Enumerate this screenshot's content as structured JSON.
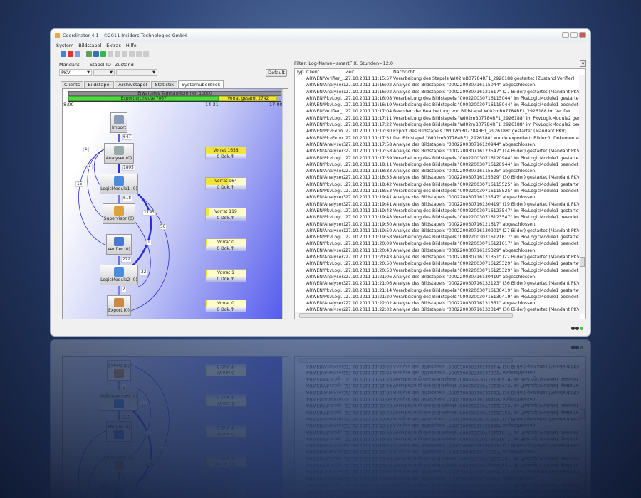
{
  "window": {
    "title": "Coordinator 4.1 - ©2011 Insiders Technologies GmbH"
  },
  "menu": [
    "System",
    "Bildstapel",
    "Extras",
    "Hilfe"
  ],
  "filters": {
    "mandant_label": "Mandant",
    "mandant_value": "PKV",
    "stapel_label": "Stapel-ID",
    "stapel_value": "",
    "zustand_label": "Zustand",
    "zustand_value": "",
    "default_button": "Default"
  },
  "tabs": [
    {
      "label": "Clients"
    },
    {
      "label": "Bildstapel"
    },
    {
      "label": "Archivstapel"
    },
    {
      "label": "Statistik"
    },
    {
      "label": "Systemüberblick",
      "active": true
    }
  ],
  "overview": {
    "expected": "Erwartetes Tagesaufkommen 10000",
    "exported": "Exportiert heute 7067",
    "stock": "Vorrat gesamt 2742",
    "exported_fraction": 0.7067,
    "stock_fraction": 0.2742,
    "time_start": "8:00",
    "time_now": "14:31",
    "time_end": "17:00",
    "nodes": [
      {
        "label": "Import",
        "icon": "scanner-icon"
      },
      {
        "label": "Analyser (0)",
        "icon": "gear-icon"
      },
      {
        "label": "LogicModule1 (0)",
        "icon": "pkv-logic-icon"
      },
      {
        "label": "Supervisor (0)",
        "icon": "supervisor-icon"
      },
      {
        "label": "Verifier (0)",
        "icon": "verifier-icon"
      },
      {
        "label": "LogicModule2 (0)",
        "icon": "pkv-logic-icon"
      },
      {
        "label": "Export (0)",
        "icon": "export-door-icon"
      }
    ],
    "edges": [
      "647",
      "1805",
      "618",
      "1195",
      "56",
      "1",
      "1",
      "1",
      "15",
      "272",
      "22",
      "2"
    ],
    "vorrat": [
      {
        "stock": "Vorrat 1658",
        "rate": "0 Dok./h",
        "fill": 1.0
      },
      {
        "stock": "Vorrat 964",
        "rate": "0 Dok./h",
        "fill": 0.58
      },
      {
        "stock": "Vorrat 119",
        "rate": "0 Dok./h",
        "fill": 0.07
      },
      {
        "stock": "Vorrat 0",
        "rate": "0 Dok./h",
        "fill": 0
      },
      {
        "stock": "Vorrat 1",
        "rate": "0 Dok./h",
        "fill": 0
      },
      {
        "stock": "Vorrat 0",
        "rate": "0 Dok./h",
        "fill": 0
      }
    ]
  },
  "log": {
    "filter": "Filter: Log-Name=smartFIX, Stunden=12,0",
    "columns": [
      "Typ",
      "Client",
      "Zeit",
      "Nachricht"
    ],
    "rows": [
      [
        "",
        "ARWEN/Verifier_...",
        "27.10.2011 11:15:57",
        "Verarbeitung des Stapels WI02mB07784RF1_2926188 gestartet (Zustand Verifier)"
      ],
      [
        "",
        "ARWEN/Analyser1",
        "27.10.2011 11:16:02",
        "Analyse des Bildstapels \"000220030716115044\" abgeschlossen."
      ],
      [
        "",
        "ARWEN/Analyser1",
        "27.10.2011 11:16:02",
        "Analyse des Bildstapels \"000220030716121617\" (27 Bilder) gestartet (Mandant PKV)."
      ],
      [
        "",
        "ARWEN/PkvLogi...",
        "27.10.2011 11:16:08",
        "Verarbeitung des Bildstapels \"000220030716115044\" im PkvLogicModule1 gestartet."
      ],
      [
        "",
        "ARWEN/PkvLogi...",
        "27.10.2011 11:16:19",
        "Verarbeitung des Bildstapels \"000220030716115044\" im PkvLogicModule1 beendet."
      ],
      [
        "",
        "ARWEN/Verifier_...",
        "27.10.2011 11:17:04",
        "Beenden der Bearbeitung von Bildstapel WI02mB07784RF1_2926188 im Verifier"
      ],
      [
        "",
        "ARWEN/PkvLogi...",
        "27.10.2011 11:17:11",
        "Verarbeitung des Bildstapels \"WI02mB07784RF1_2926188\" im PkvLogicModule2 gestartet."
      ],
      [
        "",
        "ARWEN/PkvLogi...",
        "27.10.2011 11:17:22",
        "Verarbeitung des Bildstapels \"WI02mB07784RF1_2926188\" im PkvLogicModule2 beendet."
      ],
      [
        "",
        "ARWEN/PkvExpo...",
        "27.10.2011 11:17:30",
        "Export des Bildstapels \"WI02mB07784RF1_2926188\" gestartet (Mandant PKV)"
      ],
      [
        "",
        "ARWEN/PkvExpo...",
        "27.10.2011 11:17:31",
        "Der Bildstapel \"WI02mB07784RF1_2926188\" wurde exportiert: Bilder:1, Dokumente:1"
      ],
      [
        "",
        "ARWEN/Analyser3",
        "27.10.2011 11:17:58",
        "Analyse des Bildstapels \"000220030716120944\" abgeschlossen."
      ],
      [
        "",
        "ARWEN/Analyser3",
        "27.10.2011 11:17:58",
        "Analyse des Bildstapels \"000220030716123547\" (14 Bilder) gestartet (Mandant PKV)."
      ],
      [
        "",
        "ARWEN/PkvLogi...",
        "27.10.2011 11:17:59",
        "Verarbeitung des Bildstapels \"000220030716120944\" im PkvLogicModule1 gestartet."
      ],
      [
        "",
        "ARWEN/PkvLogi...",
        "27.10.2011 11:18:11",
        "Verarbeitung des Bildstapels \"000220030716120944\" im PkvLogicModule1 beendet."
      ],
      [
        "",
        "ARWEN/Analyser2",
        "27.10.2011 11:18:33",
        "Analyse des Bildstapels \"000220030716115525\" abgeschlossen."
      ],
      [
        "",
        "ARWEN/Analyser2",
        "27.10.2011 11:18:33",
        "Analyse des Bildstapels \"000220030716125329\" (30 Bilder) gestartet (Mandant PKV)."
      ],
      [
        "",
        "ARWEN/PkvLogi...",
        "27.10.2011 11:18:42",
        "Verarbeitung des Bildstapels \"000220030716115525\" im PkvLogicModule1 gestartet."
      ],
      [
        "",
        "ARWEN/PkvLogi...",
        "27.10.2011 11:18:53",
        "Verarbeitung des Bildstapels \"000220030716115525\" im PkvLogicModule1 beendet."
      ],
      [
        "",
        "ARWEN/Analyser3",
        "27.10.2011 11:19:41",
        "Analyse des Bildstapels \"000220030716123547\" abgeschlossen."
      ],
      [
        "",
        "ARWEN/Analyser3",
        "27.10.2011 11:19:41",
        "Analyse des Bildstapels \"000220030716130419\" (19 Bilder) gestartet (Mandant PKV)."
      ],
      [
        "",
        "ARWEN/PkvLogi...",
        "27.10.2011 11:19:43",
        "Verarbeitung des Bildstapels \"000220030716123547\" im PkvLogicModule1 gestartet."
      ],
      [
        "",
        "ARWEN/PkvLogi...",
        "27.10.2011 11:19:48",
        "Verarbeitung des Bildstapels \"000220030716123547\" im PkvLogicModule1 beendet."
      ],
      [
        "",
        "ARWEN/Analyser1",
        "27.10.2011 11:19:50",
        "Analyse des Bildstapels \"000220030716121617\" abgeschlossen."
      ],
      [
        "",
        "ARWEN/Analyser1",
        "27.10.2011 11:19:50",
        "Analyse des Bildstapels \"000220030716130901\" (27 Bilder) gestartet (Mandant PKV)."
      ],
      [
        "",
        "ARWEN/PkvLogi...",
        "27.10.2011 11:19:58",
        "Verarbeitung des Bildstapels \"000220030716121617\" im PkvLogicModule1 gestartet."
      ],
      [
        "",
        "ARWEN/PkvLogi...",
        "27.10.2011 11:20:09",
        "Verarbeitung des Bildstapels \"000220030716121617\" im PkvLogicModule1 beendet."
      ],
      [
        "",
        "ARWEN/Analyser2",
        "27.10.2011 11:20:43",
        "Analyse des Bildstapels \"000220030716125329\" abgeschlossen."
      ],
      [
        "",
        "ARWEN/Analyser2",
        "27.10.2011 11:20:43",
        "Analyse des Bildstapels \"000220030716131351\" (22 Bilder) gestartet (Mandant PKV)."
      ],
      [
        "",
        "ARWEN/PkvLogi...",
        "27.10.2011 11:20:50",
        "Verarbeitung des Bildstapels \"000220030716125329\" im PkvLogicModule1 gestartet."
      ],
      [
        "",
        "ARWEN/PkvLogi...",
        "27.10.2011 11:20:53",
        "Verarbeitung des Bildstapels \"000220030716125329\" im PkvLogicModule1 beendet."
      ],
      [
        "",
        "ARWEN/Analyser3",
        "27.10.2011 11:21:06",
        "Analyse des Bildstapels \"000220030716130419\" abgeschlossen."
      ],
      [
        "",
        "ARWEN/Analyser3",
        "27.10.2011 11:21:06",
        "Analyse des Bildstapels \"000220030716132123\" (36 Bilder) gestartet (Mandant PKV)."
      ],
      [
        "",
        "ARWEN/PkvLogi...",
        "27.10.2011 11:21:14",
        "Verarbeitung des Bildstapels \"000220030716130419\" im PkvLogicModule1 gestartet."
      ],
      [
        "",
        "ARWEN/PkvLogi...",
        "27.10.2011 11:21:20",
        "Verarbeitung des Bildstapels \"000220030716130419\" im PkvLogicModule1 beendet."
      ],
      [
        "",
        "ARWEN/Analyser2",
        "27.10.2011 11:22:02",
        "Analyse des Bildstapels \"000220030716131351\" abgeschlossen."
      ],
      [
        "",
        "ARWEN/Analyser2",
        "27.10.2011 11:22:02",
        "Analyse des Bildstapels \"000220030716132314\" (30 Bilder) gestartet (Mandant PKV)."
      ]
    ]
  },
  "colors": {
    "exported": "#52d93a",
    "stock": "#f6e62a",
    "expected": "#8f8f8f",
    "edge": "#2a2fd8"
  }
}
